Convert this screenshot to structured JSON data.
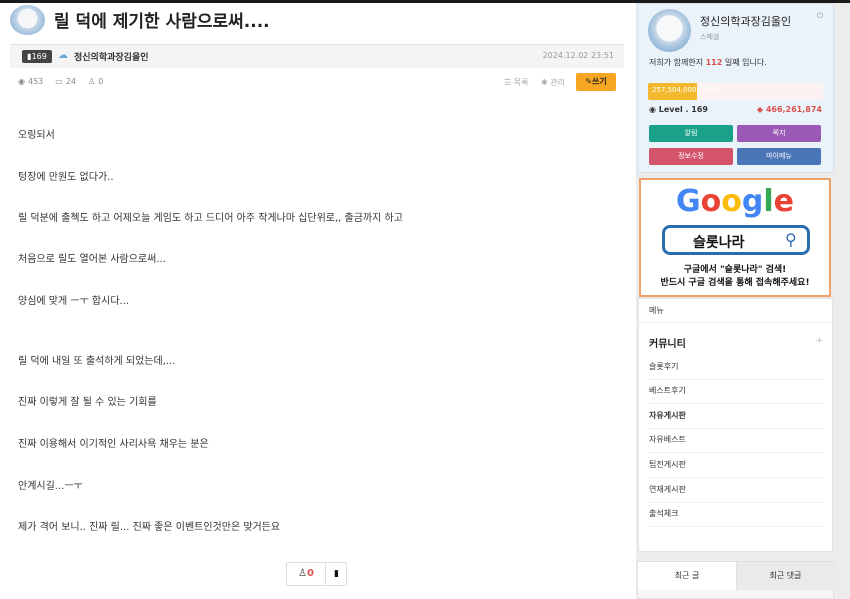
{
  "post": {
    "title": "릴 덕에 제기한 사람으로써....",
    "author_level_badge": "169",
    "author": "정신의학과장김올인",
    "date": "2024.12.02 23:51",
    "views": "453",
    "comments": "24",
    "likes": "0",
    "list_label": "목록",
    "edit_label": "관리",
    "write_label": "쓰기",
    "body_lines": [
      "오링되서",
      "텅장에 만원도 없다가..",
      "릴 덕분에 출첵도 하고 어제오늘 게임도 하고 드디어 아주 작게나마 십단위로,, 출금까지 하고",
      "처음으로 릴도 열어본 사람으로써...",
      "양심에 맞게 ㅡㅜ 합시다...",
      "릴 덕에 내일 또 출석하게 되었는데,...",
      "진짜 이렇게 잘 될 수 있는 기회를",
      "진짜 이용해서 이기적인 사리사욕 채우는 분은",
      "안계시길...ㅡㅜ",
      "제가 격어 보니.. 진짜 릴...    진짜 좋은 이벤트인것만은 맞거든요"
    ],
    "like_count": "0"
  },
  "profile": {
    "name": "정신의학과장김올인",
    "rank": "스페셜",
    "days_prefix": "저희가 함께한지",
    "days": "112",
    "days_suffix": "일째 입니다.",
    "exp_text": "257,504,000 (28%)",
    "exp_percent": 28,
    "level_label": "Level . 169",
    "points": "466,261,874",
    "buttons": [
      "알림",
      "쪽지",
      "정보수정",
      "마이메뉴"
    ],
    "button_colors": [
      "#1aa18a",
      "#9b59b6",
      "#d4556b",
      "#4a76b8"
    ]
  },
  "ad": {
    "logo": [
      "G",
      "o",
      "o",
      "g",
      "l",
      "e"
    ],
    "search_word": "슬롯나라",
    "line1": "구글에서 \"슬롯나라\" 검색!",
    "line2": "반드시 구글 검색을 통해 접속해주세요!"
  },
  "menu": {
    "header": "메뉴",
    "category": "커뮤니티",
    "plus": "+",
    "items": [
      "슬롯후기",
      "베스트후기",
      "자유게시판",
      "자유베스트",
      "팁전게시판",
      "연재게시판",
      "출석체크"
    ]
  },
  "recent": {
    "tabs": [
      "최근 글",
      "최근 댓글"
    ]
  }
}
